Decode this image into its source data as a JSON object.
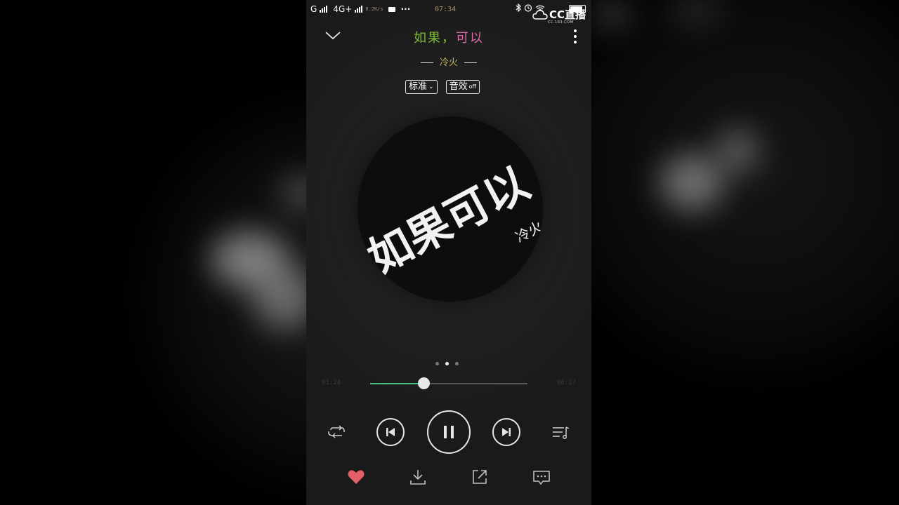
{
  "status_bar": {
    "network_1": "G",
    "network_2": "4G+",
    "speed": "0.2K/s",
    "more": "···",
    "time": "07:34"
  },
  "cc_logo": {
    "main": "CC直播",
    "sub": "CC.163.COM"
  },
  "header": {
    "title_part1": "如果，",
    "title_part2": "可以",
    "artist": "冷火"
  },
  "pills": {
    "quality_label": "标准",
    "effects_label": "音效",
    "effects_state": "off"
  },
  "album_art": {
    "main_text": "如果可以",
    "sub_text": "冷火"
  },
  "progress": {
    "current_time": "01:24",
    "total_time": "06:17",
    "fraction": 0.34
  },
  "pager": {
    "count": 3,
    "active_index": 1
  },
  "colors": {
    "progress_fill": "#3fbf7f",
    "like_heart": "#e46068",
    "title_part1": "#7fbf3c",
    "title_part2": "#e06aa8",
    "artist": "#c9b45a"
  },
  "icons": {
    "collapse": "chevron-down-icon",
    "more": "more-vertical-icon",
    "play_mode": "repeat-icon",
    "prev": "skip-previous-icon",
    "play_pause": "pause-icon",
    "next": "skip-next-icon",
    "playlist": "playlist-icon",
    "like": "heart-icon",
    "download": "download-icon",
    "share": "share-icon",
    "comment": "comment-icon"
  }
}
